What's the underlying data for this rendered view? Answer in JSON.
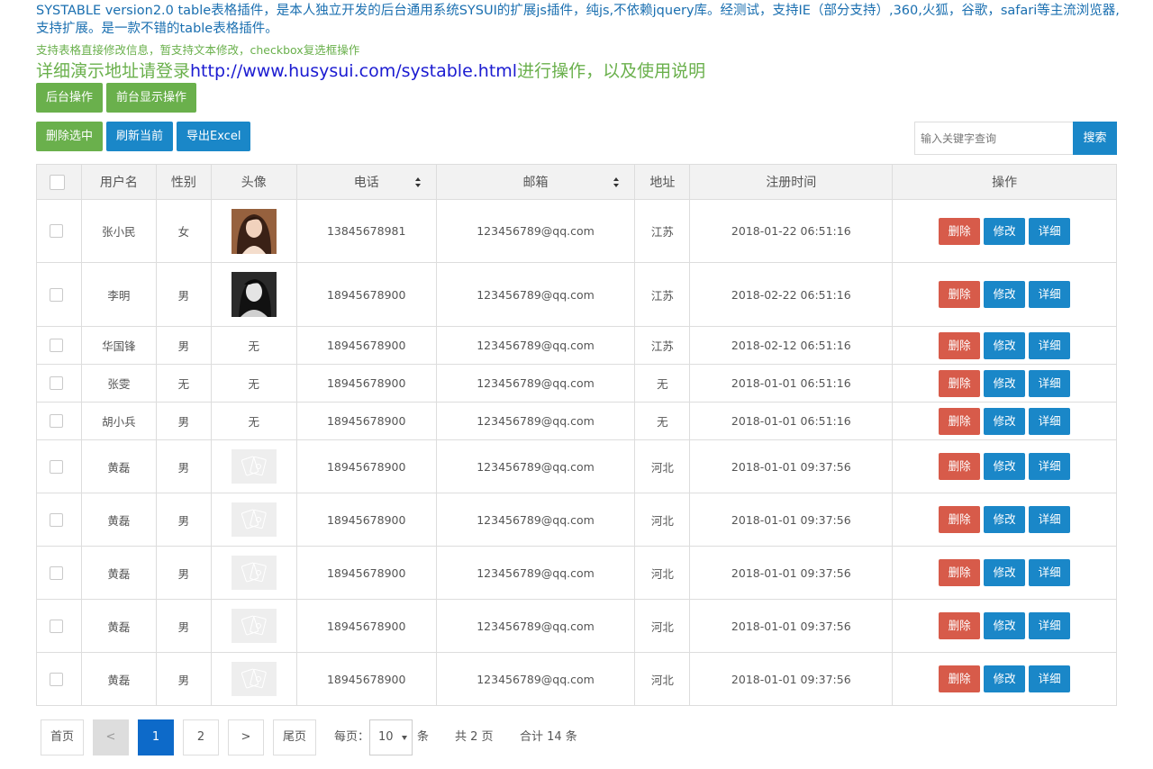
{
  "intro": "SYSTABLE version2.0 table表格插件，是本人独立开发的后台通用系统SYSUI的扩展js插件，纯js,不依赖jquery库。经测试，支持IE（部分支持）,360,火狐，谷歌，safari等主流浏览器,支持扩展。是一款不错的table表格插件。",
  "note": "支持表格直接修改信息，暂支持文本修改，checkbox复选框操作",
  "demo": {
    "prefix": "详细演示地址请登录",
    "link": "http://www.husysui.com/systable.html",
    "suffix": "进行操作，以及使用说明"
  },
  "mode_buttons": {
    "backend": "后台操作",
    "frontend": "前台显示操作"
  },
  "toolbar": {
    "delete_selected": "删除选中",
    "refresh": "刷新当前",
    "export": "导出Excel"
  },
  "search": {
    "placeholder": "输入关键字查询",
    "button": "搜索"
  },
  "table": {
    "headers": {
      "username": "用户名",
      "gender": "性别",
      "avatar": "头像",
      "phone": "电话",
      "email": "邮箱",
      "address": "地址",
      "register_time": "注册时间",
      "actions": "操作"
    },
    "action_labels": {
      "delete": "删除",
      "edit": "修改",
      "detail": "详细"
    },
    "rows": [
      {
        "username": "张小民",
        "gender": "女",
        "avatar": "photo-woman-long-hair",
        "avatar_text": "",
        "phone": "13845678981",
        "email": "123456789@qq.com",
        "address": "江苏",
        "register_time": "2018-01-22 06:51:16"
      },
      {
        "username": "李明",
        "gender": "男",
        "avatar": "photo-woman-bw",
        "avatar_text": "",
        "phone": "18945678900",
        "email": "123456789@qq.com",
        "address": "江苏",
        "register_time": "2018-02-22 06:51:16"
      },
      {
        "username": "华国锋",
        "gender": "男",
        "avatar": "none",
        "avatar_text": "无",
        "phone": "18945678900",
        "email": "123456789@qq.com",
        "address": "江苏",
        "register_time": "2018-02-12 06:51:16"
      },
      {
        "username": "张雯",
        "gender": "无",
        "avatar": "none",
        "avatar_text": "无",
        "phone": "18945678900",
        "email": "123456789@qq.com",
        "address": "无",
        "register_time": "2018-01-01 06:51:16"
      },
      {
        "username": "胡小兵",
        "gender": "男",
        "avatar": "none",
        "avatar_text": "无",
        "phone": "18945678900",
        "email": "123456789@qq.com",
        "address": "无",
        "register_time": "2018-01-01 06:51:16"
      },
      {
        "username": "黄磊",
        "gender": "男",
        "avatar": "image-placeholder-icon",
        "avatar_text": "",
        "phone": "18945678900",
        "email": "123456789@qq.com",
        "address": "河北",
        "register_time": "2018-01-01 09:37:56"
      },
      {
        "username": "黄磊",
        "gender": "男",
        "avatar": "image-placeholder-icon",
        "avatar_text": "",
        "phone": "18945678900",
        "email": "123456789@qq.com",
        "address": "河北",
        "register_time": "2018-01-01 09:37:56"
      },
      {
        "username": "黄磊",
        "gender": "男",
        "avatar": "image-placeholder-icon",
        "avatar_text": "",
        "phone": "18945678900",
        "email": "123456789@qq.com",
        "address": "河北",
        "register_time": "2018-01-01 09:37:56"
      },
      {
        "username": "黄磊",
        "gender": "男",
        "avatar": "image-placeholder-icon",
        "avatar_text": "",
        "phone": "18945678900",
        "email": "123456789@qq.com",
        "address": "河北",
        "register_time": "2018-01-01 09:37:56"
      },
      {
        "username": "黄磊",
        "gender": "男",
        "avatar": "image-placeholder-icon",
        "avatar_text": "",
        "phone": "18945678900",
        "email": "123456789@qq.com",
        "address": "河北",
        "register_time": "2018-01-01 09:37:56"
      }
    ]
  },
  "pagination": {
    "first": "首页",
    "prev": "<",
    "page1": "1",
    "page2": "2",
    "next": ">",
    "last": "尾页",
    "per_page_label": "每页：",
    "per_page_value": "10",
    "per_page_unit": "条",
    "total_pages": "共 2 页",
    "total_records": "合计 14 条"
  },
  "colors": {
    "green": "#6ab04c",
    "blue": "#1a87c8",
    "red": "#d75b4a",
    "link": "#1b1bd1",
    "intro": "#1a6fb0",
    "page_active": "#0d6ac9"
  }
}
